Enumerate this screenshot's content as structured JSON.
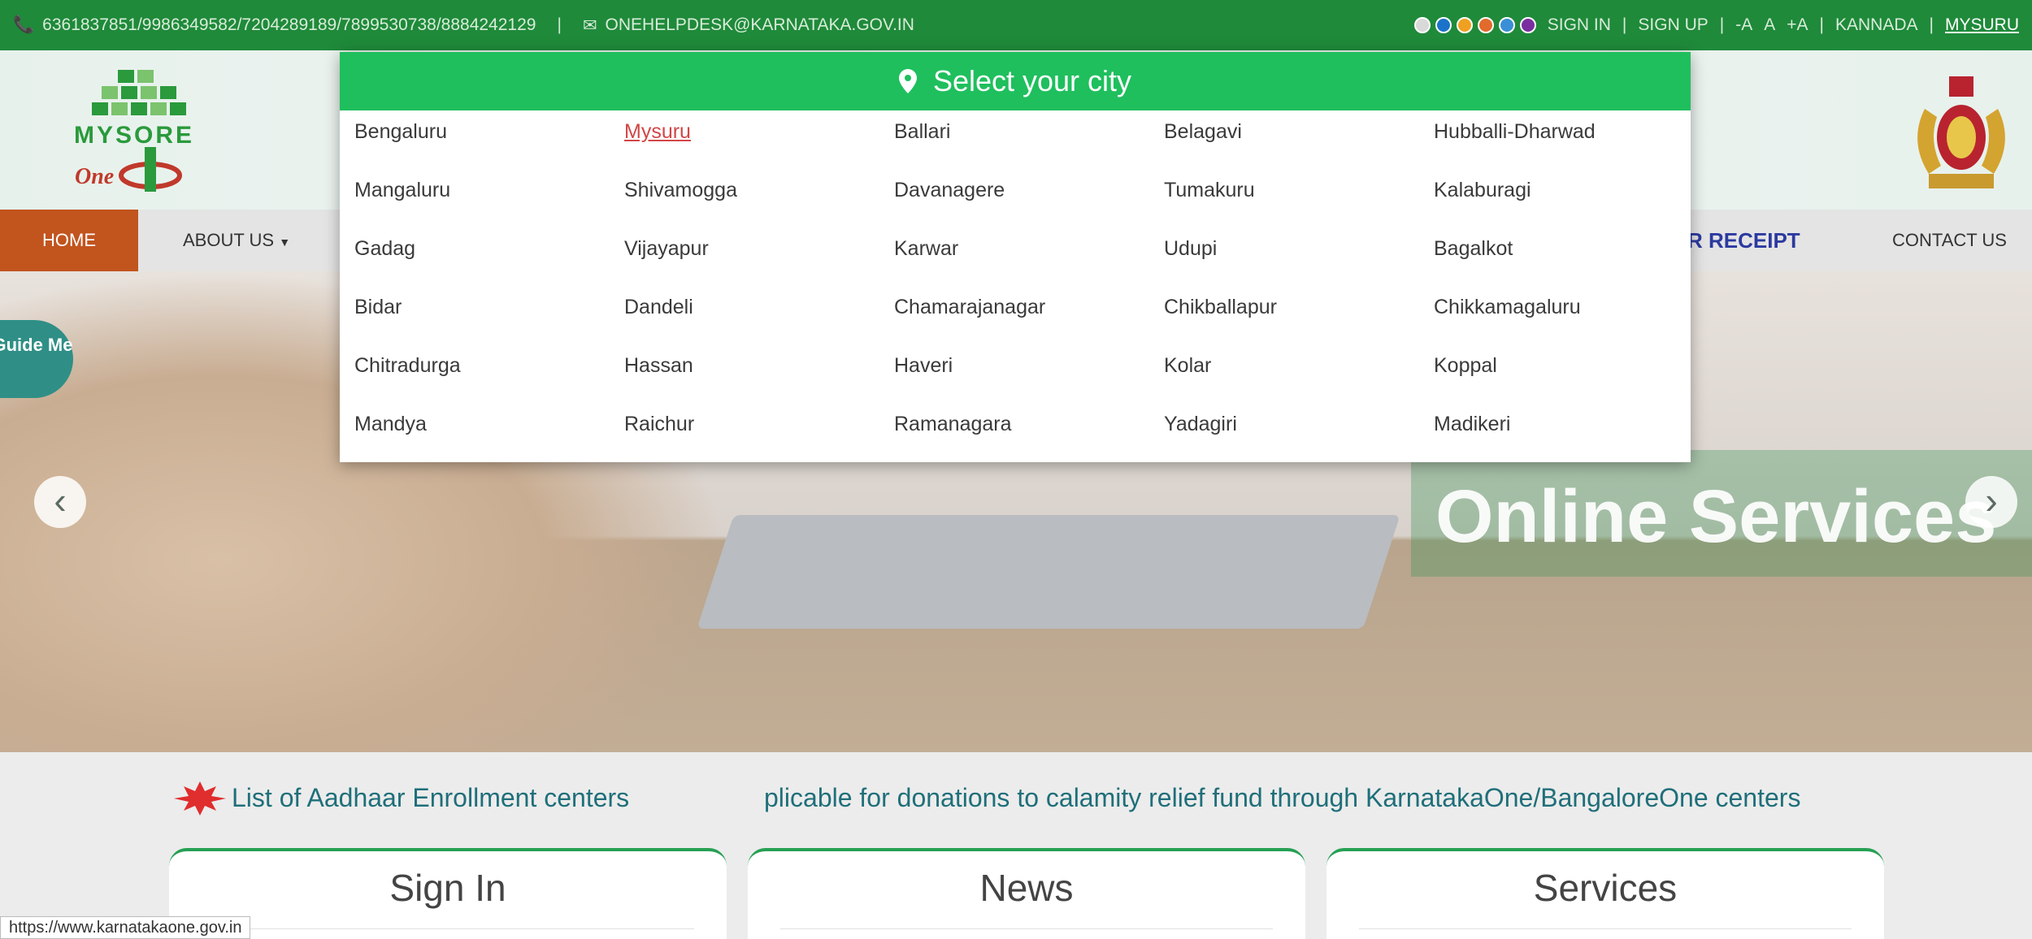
{
  "topbar": {
    "phones": "6361837851/9986349582/7204289189/7899530738/8884242129",
    "email": "ONEHELPDESK@KARNATAKA.GOV.IN",
    "sign_in": "SIGN IN",
    "sign_up": "SIGN UP",
    "font_small": "-A",
    "font_normal": "A",
    "font_large": "+A",
    "language": "KANNADA",
    "city": "MYSURU",
    "theme_colors": [
      "#d9d9d9",
      "#1a73c9",
      "#f0a020",
      "#e26a2c",
      "#3a8fd6",
      "#7a2fa0"
    ]
  },
  "header": {
    "logo_text": "MYSORE",
    "logo_sub": "One"
  },
  "nav": {
    "home": "HOME",
    "about": "ABOUT US",
    "receipt_partial": "R RECEIPT",
    "contact": "CONTACT US"
  },
  "hero": {
    "banner": "Online Services",
    "prev_icon": "chevron-left-icon",
    "next_icon": "chevron-right-icon"
  },
  "guide_me": "Guide Me",
  "marquee": {
    "item1": "List of Aadhaar Enrollment centers",
    "item2": "plicable for donations to calamity relief fund through KarnatakaOne/BangaloreOne centers"
  },
  "cards": {
    "signin": "Sign In",
    "news": "News",
    "services": "Services"
  },
  "status_url": "https://www.karnatakaone.gov.in",
  "city_modal": {
    "title": "Select your city",
    "selected": "Mysuru",
    "cities": [
      [
        "Bengaluru",
        "Mysuru",
        "Ballari",
        "Belagavi",
        "Hubballi-Dharwad"
      ],
      [
        "Mangaluru",
        "Shivamogga",
        "Davanagere",
        "Tumakuru",
        "Kalaburagi"
      ],
      [
        "Gadag",
        "Vijayapur",
        "Karwar",
        "Udupi",
        "Bagalkot"
      ],
      [
        "Bidar",
        "Dandeli",
        "Chamarajanagar",
        "Chikballapur",
        "Chikkamagaluru"
      ],
      [
        "Chitradurga",
        "Hassan",
        "Haveri",
        "Kolar",
        "Koppal"
      ],
      [
        "Mandya",
        "Raichur",
        "Ramanagara",
        "Yadagiri",
        "Madikeri"
      ]
    ]
  }
}
